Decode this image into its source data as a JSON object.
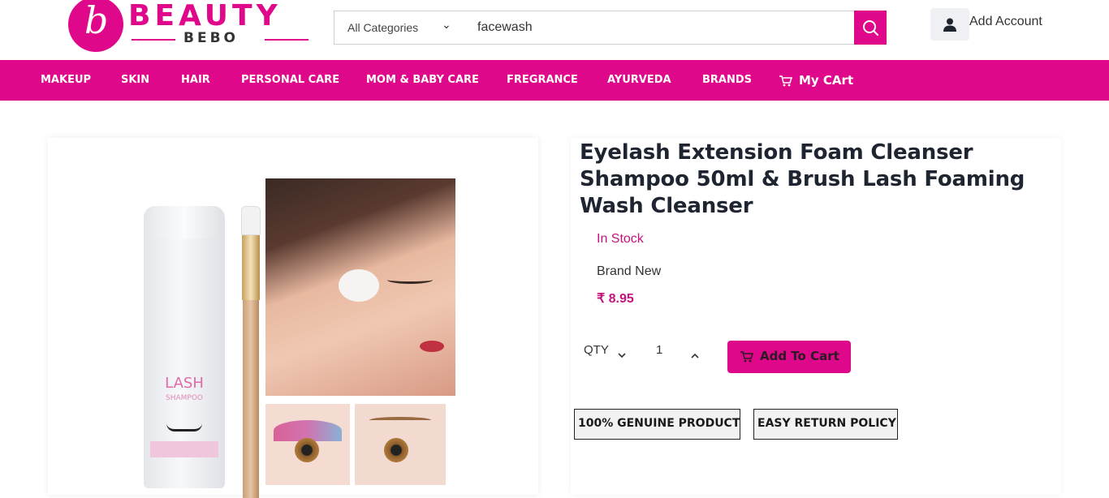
{
  "brand": {
    "logo_initial": "b",
    "logo_main": "BEAUTY",
    "logo_sub": "BEBO",
    "accent_color": "#e0088a"
  },
  "search": {
    "category": "All Categories",
    "value": "facewash",
    "icon": "search-icon"
  },
  "account": {
    "label": "Add Account",
    "icon": "user-icon"
  },
  "nav": {
    "items": [
      "MAKEUP",
      "SKIN",
      "HAIR",
      "PERSONAL CARE",
      "MOM & BABY CARE",
      "FREGRANCE",
      "AYURVEDA",
      "BRANDS"
    ],
    "cart_label": "My CArt",
    "cart_icon": "cart-icon"
  },
  "product": {
    "image_text": {
      "bottle_label": "LASH",
      "bottle_sub": "SHAMPOO"
    },
    "title": "Eyelash Extension Foam Cleanser Shampoo 50ml & Brush Lash Foaming Wash Cleanser",
    "stock": "In Stock",
    "condition": "Brand New",
    "price": "₹ 8.95",
    "qty_label": "QTY",
    "qty_value": "1",
    "add_to_cart_label": "Add To Cart",
    "badges": [
      "100% GENUINE PRODUCT",
      "EASY RETURN POLICY"
    ]
  }
}
